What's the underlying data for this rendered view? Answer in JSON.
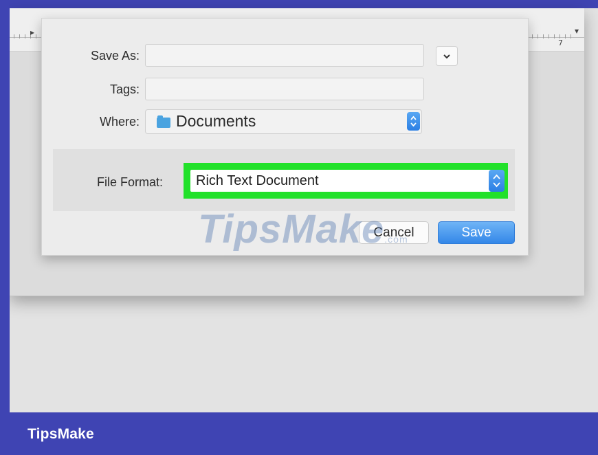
{
  "dialog": {
    "save_as_label": "Save As:",
    "save_as_value": "",
    "tags_label": "Tags:",
    "tags_value": "",
    "where_label": "Where:",
    "where_value": "Documents",
    "where_icon": "folder-icon",
    "expand_icon": "chevron-down-icon",
    "file_format_label": "File Format:",
    "file_format_value": "Rich Text Document",
    "cancel_label": "Cancel",
    "save_label": "Save"
  },
  "ruler": {
    "marker_left": "▸",
    "marker_right": "▾",
    "number": "7"
  },
  "watermark": {
    "text": "TipsMake",
    "suffix": ".com"
  },
  "brand": {
    "label": "TipsMake"
  },
  "colors": {
    "frame": "#3f44b3",
    "highlight": "#22e12a",
    "accent_blue": "#3387e8"
  }
}
